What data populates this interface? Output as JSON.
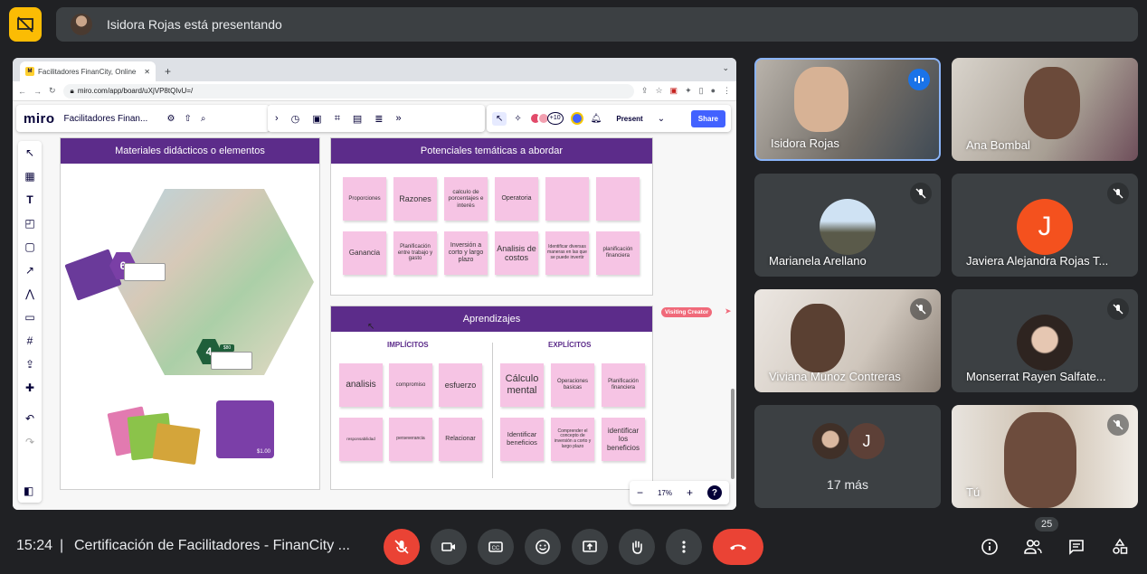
{
  "presenting": {
    "text": "Isidora Rojas está presentando"
  },
  "browser": {
    "tab_title": "Facilitadores FinanCity, Online",
    "tab_favicon": "M",
    "new_tab": "+",
    "url": "miro.com/app/board/uXjVP8tQIvU=/"
  },
  "miro": {
    "logo": "miro",
    "board_name": "Facilitadores Finan...",
    "collab_more": "+10",
    "present": "Present",
    "share": "Share"
  },
  "board": {
    "materials_title": "Materiales didácticos o elementos",
    "themes_title": "Potenciales temáticas a abordar",
    "themes_notes": [
      "Proporciones",
      "Razones",
      "calculo de porcentajes e interés",
      "Operatoria",
      "",
      "",
      "Ganancia",
      "Planificación entre trabajo y gasto",
      "Inversión a corto y largo plazo",
      "Analisis de costos",
      "Identificar diversas maneras en las que se puede invertir",
      "planificación financiera"
    ],
    "learn_title": "Aprendizajes",
    "implicit_head": "IMPLÍCITOS",
    "explicit_head": "EXPLÍCITOS",
    "implicit_notes": [
      "analisis",
      "compromiso",
      "esfuerzo",
      "responsabilidad",
      "perseverancia",
      "Relacionar"
    ],
    "explicit_notes": [
      "Cálculo mental",
      "Operaciones basicas",
      "Planificación financiera",
      "Identificar beneficios",
      "Comprender el concepto de inversión a corto y largo plazo",
      "identificar los beneficios"
    ],
    "visiting": "Visiting Creator",
    "zoom": "17%",
    "zoom_minus": "−",
    "zoom_plus": "+",
    "help": "?",
    "badge6": "6",
    "badge4": "4",
    "price": "$80",
    "card_price": "$1.00"
  },
  "participants": [
    {
      "name": "Isidora Rojas"
    },
    {
      "name": "Ana Bombal"
    },
    {
      "name": "Marianela Arellano"
    },
    {
      "name": "Javiera Alejandra Rojas T...",
      "initial": "J"
    },
    {
      "name": "Viviana Munoz Contreras"
    },
    {
      "name": "Monserrat Rayen Salfate..."
    },
    {
      "name": "17 más",
      "initial": "J"
    },
    {
      "name": "Tú"
    }
  ],
  "bottom": {
    "clock": "15:24",
    "title": "Certificación de Facilitadores - FinanCity ...",
    "people_count": "25"
  },
  "colors": {
    "accent_purple": "#5c2c8a",
    "sticky_pink": "#f6c4e4",
    "end_call": "#ea4335",
    "speaking_blue": "#8ab4f8"
  }
}
